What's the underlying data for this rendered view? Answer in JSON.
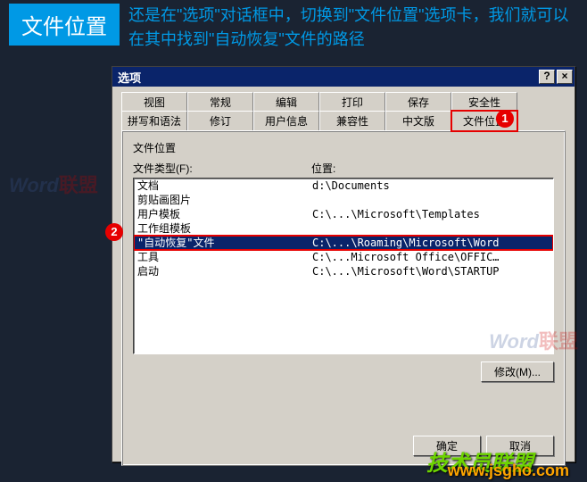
{
  "header": {
    "badge": "文件位置",
    "text": "还是在\"选项\"对话框中，切换到\"文件位置\"选项卡，我们就可以在其中找到\"自动恢复\"文件的路径"
  },
  "dialog": {
    "title": "选项",
    "help_btn": "?",
    "close_btn": "×"
  },
  "tabs_row1": [
    "视图",
    "常规",
    "编辑",
    "打印",
    "保存",
    "安全性"
  ],
  "tabs_row2": [
    "拼写和语法",
    "修订",
    "用户信息",
    "兼容性",
    "中文版",
    "文件位置"
  ],
  "markers": {
    "m1": "1",
    "m2": "2"
  },
  "section": {
    "title": "文件位置",
    "col1": "文件类型(F):",
    "col2": "位置:"
  },
  "rows": [
    {
      "c1": "文档",
      "c2": "d:\\Documents"
    },
    {
      "c1": "剪贴画图片",
      "c2": ""
    },
    {
      "c1": "用户模板",
      "c2": "C:\\...\\Microsoft\\Templates"
    },
    {
      "c1": "工作组模板",
      "c2": ""
    },
    {
      "c1": "\"自动恢复\"文件",
      "c2": "C:\\...\\Roaming\\Microsoft\\Word"
    },
    {
      "c1": "工具",
      "c2": "C:\\...Microsoft Office\\OFFIC…"
    },
    {
      "c1": "启动",
      "c2": "C:\\...\\Microsoft\\Word\\STARTUP"
    }
  ],
  "buttons": {
    "modify": "修改(M)...",
    "ok": "确定",
    "cancel": "取消"
  },
  "watermarks": {
    "w1a": "Word",
    "w1b": "联盟",
    "w2a": "Word",
    "w2b": "联盟"
  },
  "brand": "技术员联盟",
  "url": "www.jsgho.com"
}
